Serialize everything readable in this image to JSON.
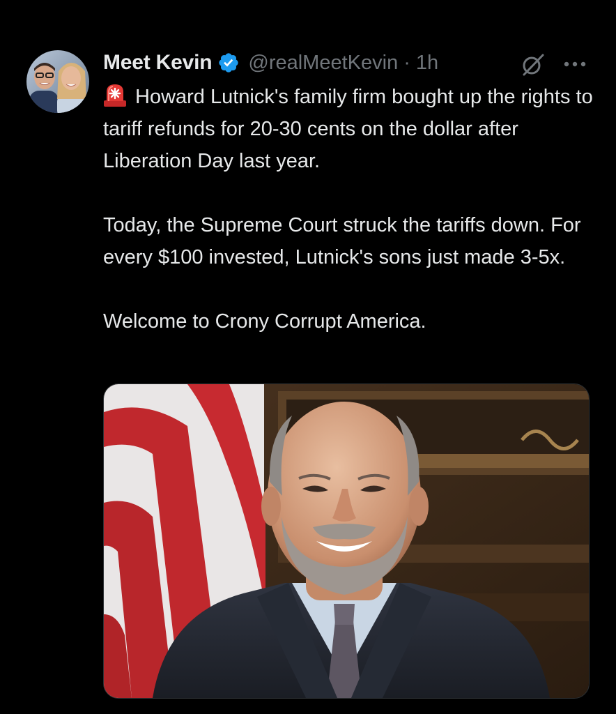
{
  "tweet": {
    "author": {
      "display_name": "Meet Kevin",
      "handle": "@realMeetKevin",
      "verified": true,
      "avatar": "avatar-photo"
    },
    "separator": "·",
    "time": "1h",
    "icons": {
      "verified": "verified-badge-icon",
      "grok": "grok-icon",
      "more": "more-options-icon",
      "siren": "rotating-light-emoji"
    },
    "text": {
      "line1": "Howard Lutnick's family firm bought up the rights to tariff refunds for 20-30 cents on the dollar after Liberation Day last year.",
      "line2": "Today, the Supreme Court struck the tariffs down. For every $100 invested, Lutnick's sons just made 3-5x.",
      "line3": "Welcome to Crony Corrupt America."
    },
    "media": {
      "type": "photo",
      "subject": "portrait-photo"
    },
    "colors": {
      "background": "#000000",
      "text": "#e7e9ea",
      "secondary": "#71767b",
      "verified": "#1d9bf0"
    }
  }
}
